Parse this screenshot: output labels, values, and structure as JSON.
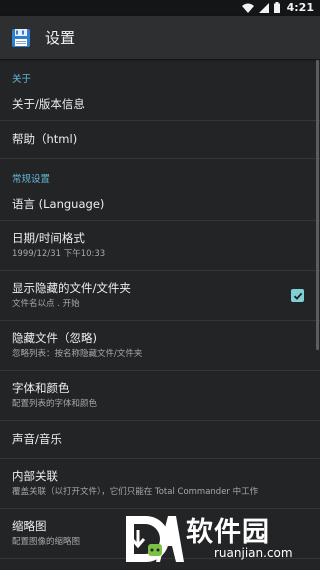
{
  "status_bar": {
    "time": "4:21"
  },
  "app_bar": {
    "title": "设置"
  },
  "sections": {
    "about": "关于",
    "general": "常规设置"
  },
  "items": {
    "about_version": {
      "title": "关于/版本信息"
    },
    "help": {
      "title": "帮助（html)"
    },
    "language": {
      "title": "语言 (Language)"
    },
    "datetime": {
      "title": "日期/时间格式",
      "subtitle": "1999/12/31  下午10:33"
    },
    "show_hidden": {
      "title": "显示隐藏的文件/文件夹",
      "subtitle": "文件名以点 . 开始",
      "checked": true
    },
    "hide_files": {
      "title": "隐藏文件（忽略)",
      "subtitle": "忽略列表：按名称隐藏文件/文件夹"
    },
    "font_color": {
      "title": "字体和颜色",
      "subtitle": "配置列表的字体和颜色"
    },
    "sound": {
      "title": "声音/音乐"
    },
    "internal_assoc": {
      "title": "内部关联",
      "subtitle": "覆盖关联（以打开文件），它们只能在 Total Commander 中工作"
    },
    "thumbnails": {
      "title": "缩略图",
      "subtitle": "配置图像的缩略图"
    }
  },
  "watermark": {
    "text": "软件园",
    "subtext": "ruanjian.com"
  },
  "colors": {
    "accent": "#63b8d6",
    "checkbox": "#7fd0d4",
    "background": "#222426"
  }
}
